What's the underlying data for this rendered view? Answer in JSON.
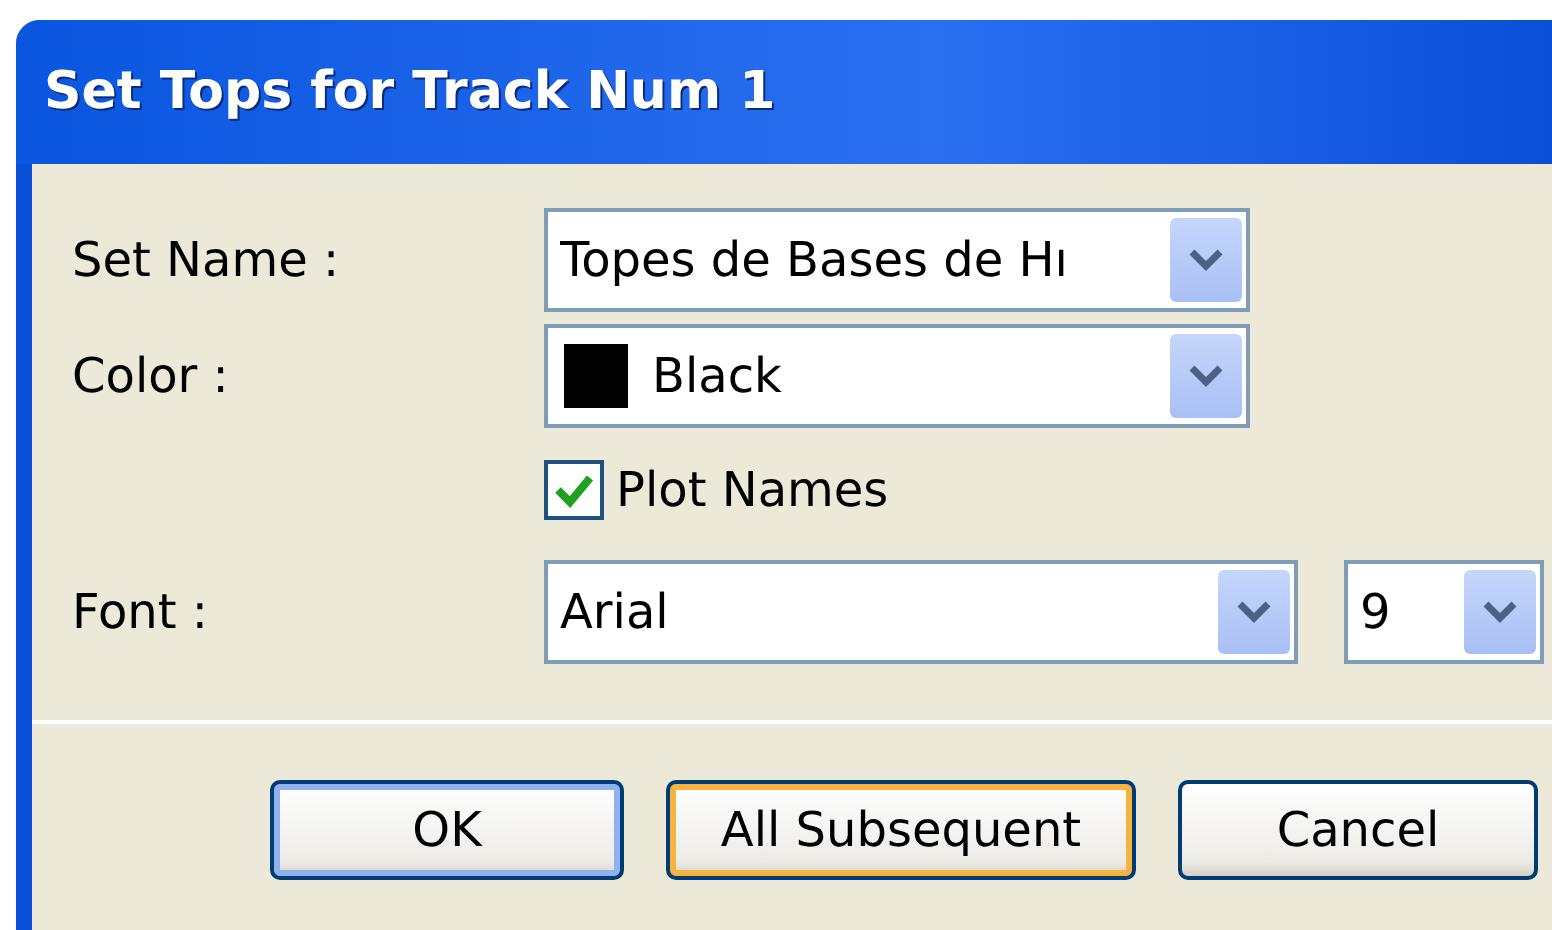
{
  "window": {
    "title": "Set Tops for Track Num 1"
  },
  "fields": [
    {
      "label": "Set Name :",
      "value": "Topes de Bases de Hı"
    },
    {
      "label": "Color :",
      "value": "Black",
      "color": "#000000"
    }
  ],
  "plot_names": {
    "label": "Plot Names",
    "checked": true
  },
  "font": {
    "label": "Font :",
    "value": "Arial",
    "size": "9"
  },
  "buttons": [
    {
      "label": "OK",
      "kind": "default"
    },
    {
      "label": "All Subsequent",
      "kind": "hover"
    },
    {
      "label": "Cancel",
      "kind": "normal"
    }
  ]
}
